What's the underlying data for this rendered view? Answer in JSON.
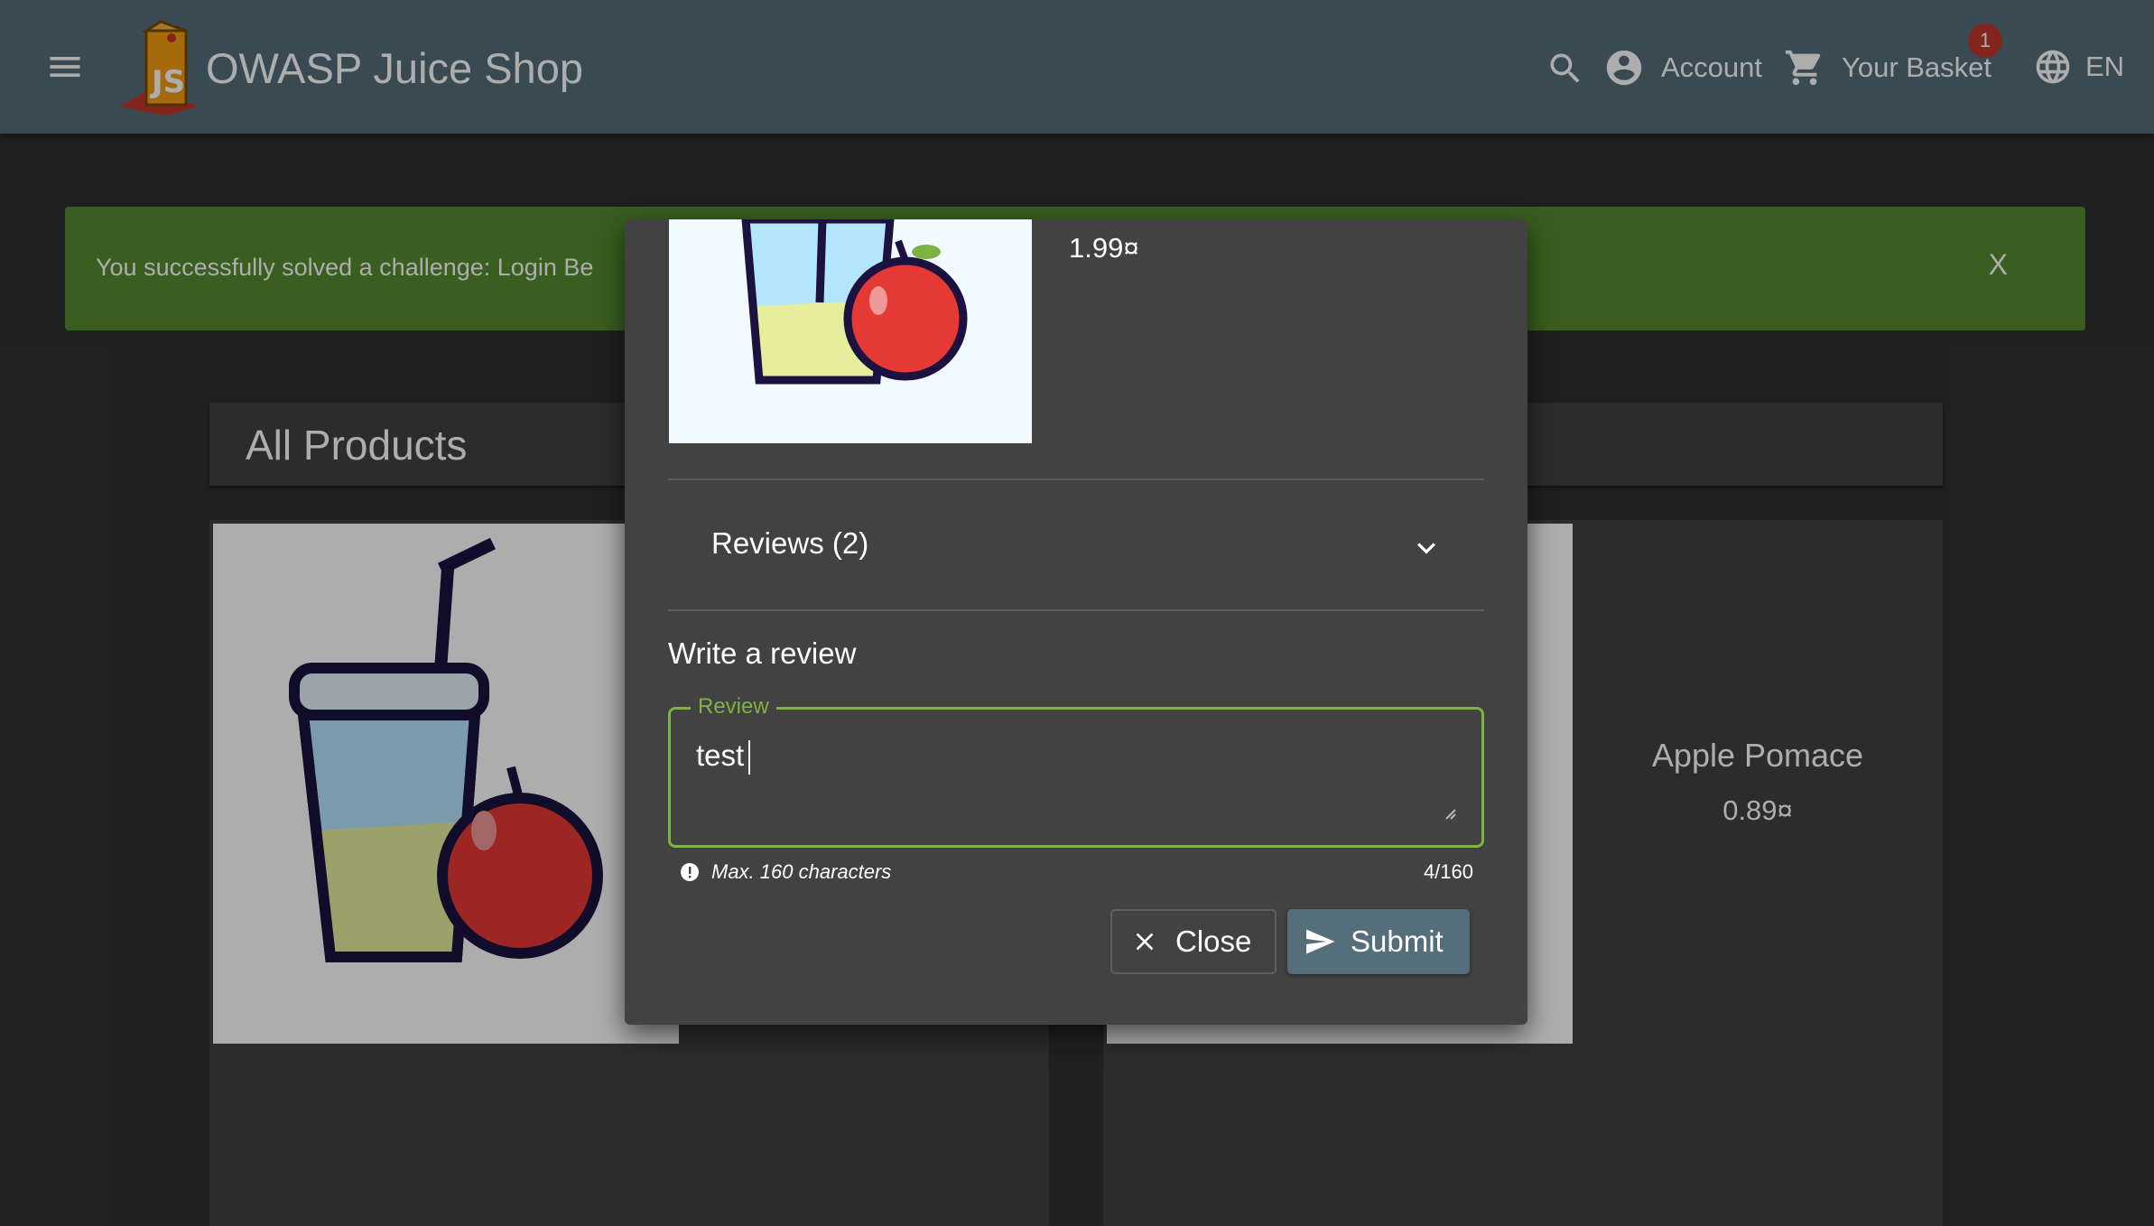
{
  "toolbar": {
    "app_name": "OWASP Juice Shop",
    "account_label": "Account",
    "basket_label": "Your Basket",
    "basket_count": "1",
    "language_label": "EN"
  },
  "notification": {
    "text": "You successfully solved a challenge: Login Be",
    "close_label": "X"
  },
  "heading": {
    "title": "All Products"
  },
  "products": [
    {
      "name": "Apple Pomace",
      "price": "0.89¤"
    }
  ],
  "dialog": {
    "price": "1.99¤",
    "reviews_label": "Reviews (2)",
    "write_review_title": "Write a review",
    "review_field_label": "Review",
    "review_value": "test",
    "hint": "Max. 160 characters",
    "char_count": "4/160",
    "close_label": "Close",
    "submit_label": "Submit"
  },
  "colors": {
    "toolbar": "#546e7a",
    "notification": "#558b2f",
    "field_accent": "#7cb342",
    "submit_button": "#546e7a",
    "badge": "#c0392b"
  },
  "icons": [
    "menu-icon",
    "logo-icon",
    "search-icon",
    "account-icon",
    "cart-icon",
    "language-icon",
    "chevron-down-icon",
    "info-icon",
    "close-icon",
    "send-icon",
    "resize-handle-icon"
  ]
}
